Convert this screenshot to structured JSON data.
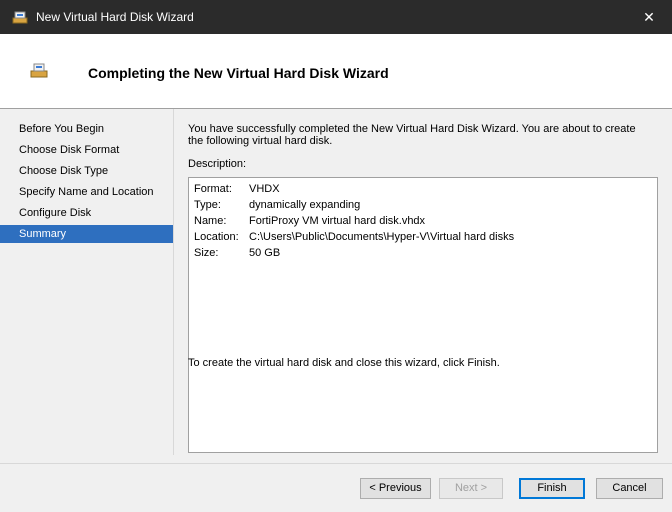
{
  "window": {
    "title": "New Virtual Hard Disk Wizard",
    "close_glyph": "✕"
  },
  "header": {
    "heading": "Completing the New Virtual Hard Disk Wizard",
    "icon": "disk-wizard-icon"
  },
  "nav": {
    "items": [
      {
        "label": "Before You Begin",
        "selected": false
      },
      {
        "label": "Choose Disk Format",
        "selected": false
      },
      {
        "label": "Choose Disk Type",
        "selected": false
      },
      {
        "label": "Specify Name and Location",
        "selected": false
      },
      {
        "label": "Configure Disk",
        "selected": false
      },
      {
        "label": "Summary",
        "selected": true
      }
    ]
  },
  "content": {
    "intro": "You have successfully completed the New Virtual Hard Disk Wizard. You are about to create the following virtual hard disk.",
    "description_label": "Description:",
    "summary": [
      {
        "key": "Format:",
        "value": "VHDX"
      },
      {
        "key": "Type:",
        "value": "dynamically expanding"
      },
      {
        "key": "Name:",
        "value": "FortiProxy VM virtual hard disk.vhdx"
      },
      {
        "key": "Location:",
        "value": "C:\\Users\\Public\\Documents\\Hyper-V\\Virtual hard disks"
      },
      {
        "key": "Size:",
        "value": "50 GB"
      }
    ],
    "outro": "To create the virtual hard disk and close this wizard, click Finish."
  },
  "buttons": {
    "previous": "< Previous",
    "next": "Next >",
    "finish": "Finish",
    "cancel": "Cancel"
  },
  "colors": {
    "selection": "#2e6fbf",
    "titlebar": "#2b2b2b"
  }
}
